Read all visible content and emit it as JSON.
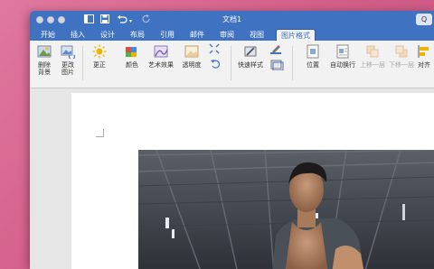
{
  "window": {
    "title": "文档1"
  },
  "toolbar": {
    "search_symbol": "Q"
  },
  "tabs": [
    "开始",
    "插入",
    "设计",
    "布局",
    "引用",
    "邮件",
    "审阅",
    "视图",
    "图片格式"
  ],
  "active_tab": "图片格式",
  "ribbon": {
    "remove_bg": "删除\n背景",
    "change_pic": "更改\n图片",
    "corrections": "更正",
    "color": "颜色",
    "art_effects": "艺术效果",
    "transparency": "透明度",
    "quick_styles": "快速样式",
    "position": "位置",
    "wrap_text": "自动换行",
    "bring_forward": "上移一层",
    "send_backward": "下移一层",
    "align": "对齐"
  },
  "colors": {
    "accent": "#3f72c1",
    "ribbon_bg": "#f2f2f2"
  }
}
